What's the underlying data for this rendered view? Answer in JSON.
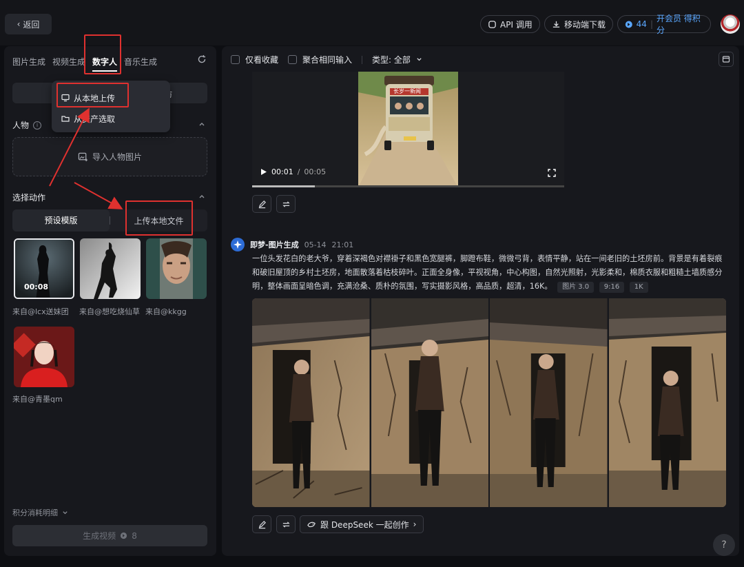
{
  "header": {
    "back_label": "返回",
    "api_label": "API 调用",
    "mobile_label": "移动端下载",
    "points": "44",
    "vip_label": "开会员 得积分"
  },
  "left": {
    "tabs": [
      {
        "label": "图片生成"
      },
      {
        "label": "视频生成"
      },
      {
        "label": "数字人"
      },
      {
        "label": "音乐生成"
      }
    ],
    "upload_menu": {
      "partial_right": "仿",
      "items": [
        {
          "label": "从本地上传"
        },
        {
          "label": "从资产选取"
        }
      ]
    },
    "person_section": {
      "title": "人物",
      "info": "i",
      "dropzone_label": "导入人物图片"
    },
    "action_section": {
      "title": "选择动作",
      "opt_preset": "预设模版",
      "opt_upload": "上传本地文件"
    },
    "templates": [
      {
        "caption": "来自@lcx送妹团",
        "duration": "00:08"
      },
      {
        "caption": "来自@想吃烧仙草"
      },
      {
        "caption": "来自@kkgg"
      },
      {
        "caption": "来自@青墨qm"
      }
    ],
    "cost_label": "积分消耗明细",
    "generate_label": "生成视频",
    "generate_cost": "8"
  },
  "right": {
    "filters": {
      "fav_only": "仅看收藏",
      "aggregate": "聚合相同输入",
      "type_label": "类型: 全部"
    },
    "video": {
      "sign_text": "长岁一新闻",
      "time_current": "00:01",
      "time_sep": "/",
      "time_total": "00:05",
      "progress": 0.2
    },
    "message": {
      "source": "即梦-图片生成",
      "date": "05-14",
      "time": "21:01",
      "prompt": "一位头发花白的老大爷，穿着深褐色对襟褂子和黑色宽腿裤，脚蹬布鞋，微微弓背，表情平静，站在一间老旧的土坯房前。背景是有着裂痕和破旧屋顶的乡村土坯房，地面散落着枯枝碎叶。正面全身像，平视视角，中心构图，自然光照射，光影柔和，棉质衣服和粗糙土墙质感分明，整体画面呈暗色调，充满沧桑、质朴的氛围，写实摄影风格，高品质，超清，16K。",
      "tags": [
        "图片 3.0",
        "9:16",
        "1K"
      ]
    },
    "deepseek_label": "跟 DeepSeek 一起创作"
  },
  "help_label": "?",
  "colors": {
    "highlight": "#e0312f",
    "accent": "#5aa7ff"
  }
}
